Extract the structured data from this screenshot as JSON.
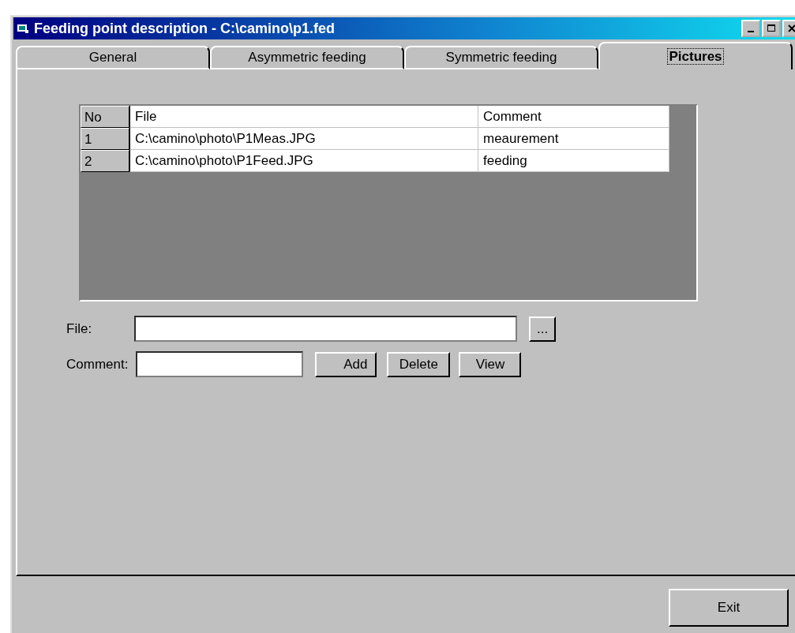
{
  "window": {
    "title": "Feeding point description - C:\\camino\\p1.fed"
  },
  "tabs": [
    {
      "label": "General",
      "selected": false
    },
    {
      "label": "Asymmetric feeding",
      "selected": false
    },
    {
      "label": "Symmetric feeding",
      "selected": false
    },
    {
      "label": "Pictures",
      "selected": true
    }
  ],
  "table": {
    "columns": [
      "No",
      "File",
      "Comment"
    ],
    "rows": [
      [
        "1",
        "C:\\camino\\photo\\P1Meas.JPG",
        "meaurement"
      ],
      [
        "2",
        "C:\\camino\\photo\\P1Feed.JPG",
        "feeding"
      ]
    ]
  },
  "file_label": "File:",
  "browse_button": "...",
  "comment_label": "Comment:",
  "buttons": [
    "Add",
    "Delete",
    "View"
  ],
  "exit_button": "Exit"
}
